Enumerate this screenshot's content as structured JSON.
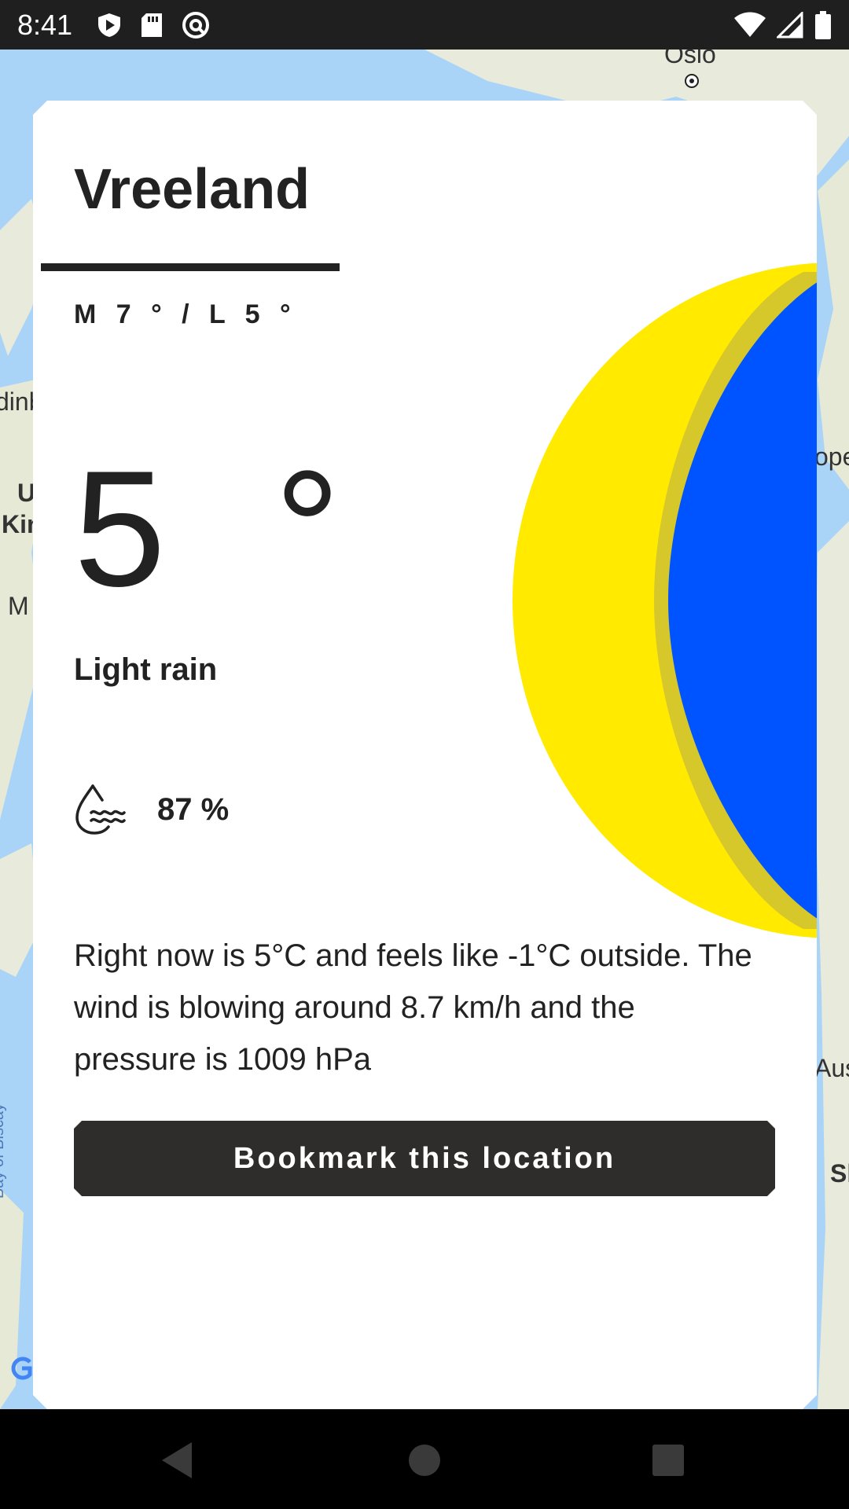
{
  "status_bar": {
    "time": "8:41",
    "icons_left": [
      "play-protect-icon",
      "sd-card-icon",
      "vpn-icon"
    ],
    "icons_right": [
      "wifi-icon",
      "cell-signal-icon",
      "battery-icon"
    ]
  },
  "map": {
    "labels": [
      "Oslo",
      "dinb",
      "U",
      "Kin",
      "M",
      "ope",
      "Aus",
      "Sl",
      "Bay of Biscay"
    ]
  },
  "weather": {
    "city": "Vreeland",
    "high_low": "M 7 ° / L 5 °",
    "temperature": "5 °",
    "condition": "Light rain",
    "humidity": "87 %",
    "description": "Right now is 5°C and feels like -1°C outside. The wind is blowing around 8.7 km/h and the pressure is 1009 hPa",
    "moon_colors": {
      "lit": "#ffea00",
      "rim": "#d6c72a",
      "dark": "#0054ff"
    }
  },
  "actions": {
    "bookmark_label": "Bookmark this location"
  },
  "nav": {
    "items": [
      "back-icon",
      "home-icon",
      "recents-icon"
    ]
  }
}
